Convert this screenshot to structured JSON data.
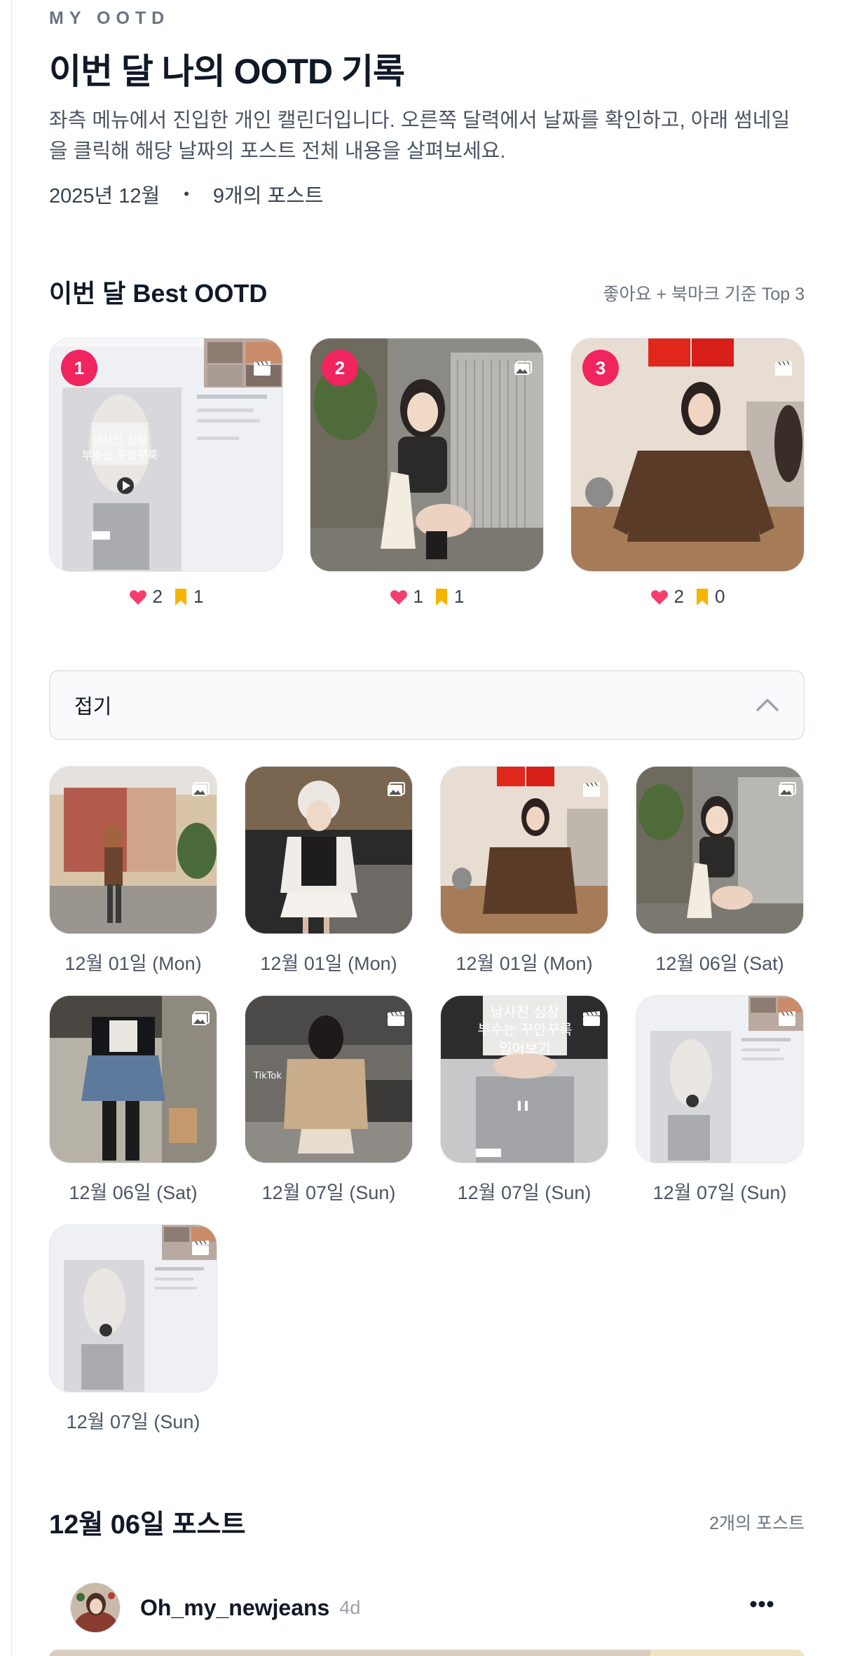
{
  "header": {
    "eyebrow": "MY OOTD",
    "title": "이번 달 나의 OOTD 기록",
    "description": "좌측 메뉴에서 진입한 개인 캘린더입니다. 오른쪽 달력에서 날짜를 확인하고, 아래 썸네일을 클릭해 해당 날짜의 포스트 전체 내용을 살펴보세요.",
    "month": "2025년 12월",
    "separator": "•",
    "post_count": "9개의 포스트"
  },
  "best": {
    "title": "이번 달 Best OOTD",
    "criteria": "좋아요 + 북마크 기준 Top 3",
    "items": [
      {
        "rank": "1",
        "type_icon": "video-icon",
        "likes": "2",
        "bookmarks": "1"
      },
      {
        "rank": "2",
        "type_icon": "image-icon",
        "likes": "1",
        "bookmarks": "1"
      },
      {
        "rank": "3",
        "type_icon": "video-icon",
        "likes": "2",
        "bookmarks": "0"
      }
    ]
  },
  "toggle": {
    "label": "접기",
    "icon": "chevron-up-icon"
  },
  "posts": [
    {
      "date": "12월 01일 (Mon)",
      "type_icon": "image-icon"
    },
    {
      "date": "12월 01일 (Mon)",
      "type_icon": "image-icon"
    },
    {
      "date": "12월 01일 (Mon)",
      "type_icon": "video-icon"
    },
    {
      "date": "12월 06일 (Sat)",
      "type_icon": "image-icon"
    },
    {
      "date": "12월 06일 (Sat)",
      "type_icon": "image-icon"
    },
    {
      "date": "12월 07일 (Sun)",
      "type_icon": "video-icon"
    },
    {
      "date": "12월 07일 (Sun)",
      "type_icon": "video-icon"
    },
    {
      "date": "12월 07일 (Sun)",
      "type_icon": "video-icon"
    },
    {
      "date": "12월 07일 (Sun)",
      "type_icon": "video-icon"
    }
  ],
  "day_section": {
    "title": "12월 06일 포스트",
    "count": "2개의 포스트"
  },
  "feed": {
    "username": "Oh_my_newjeans",
    "time": "4d",
    "more_icon": "more-horizontal-icon"
  },
  "colors": {
    "rank_badge": "#f0245f",
    "like": "#f43f6e",
    "bookmark": "#f5b400",
    "muted_text": "#6b7280"
  }
}
